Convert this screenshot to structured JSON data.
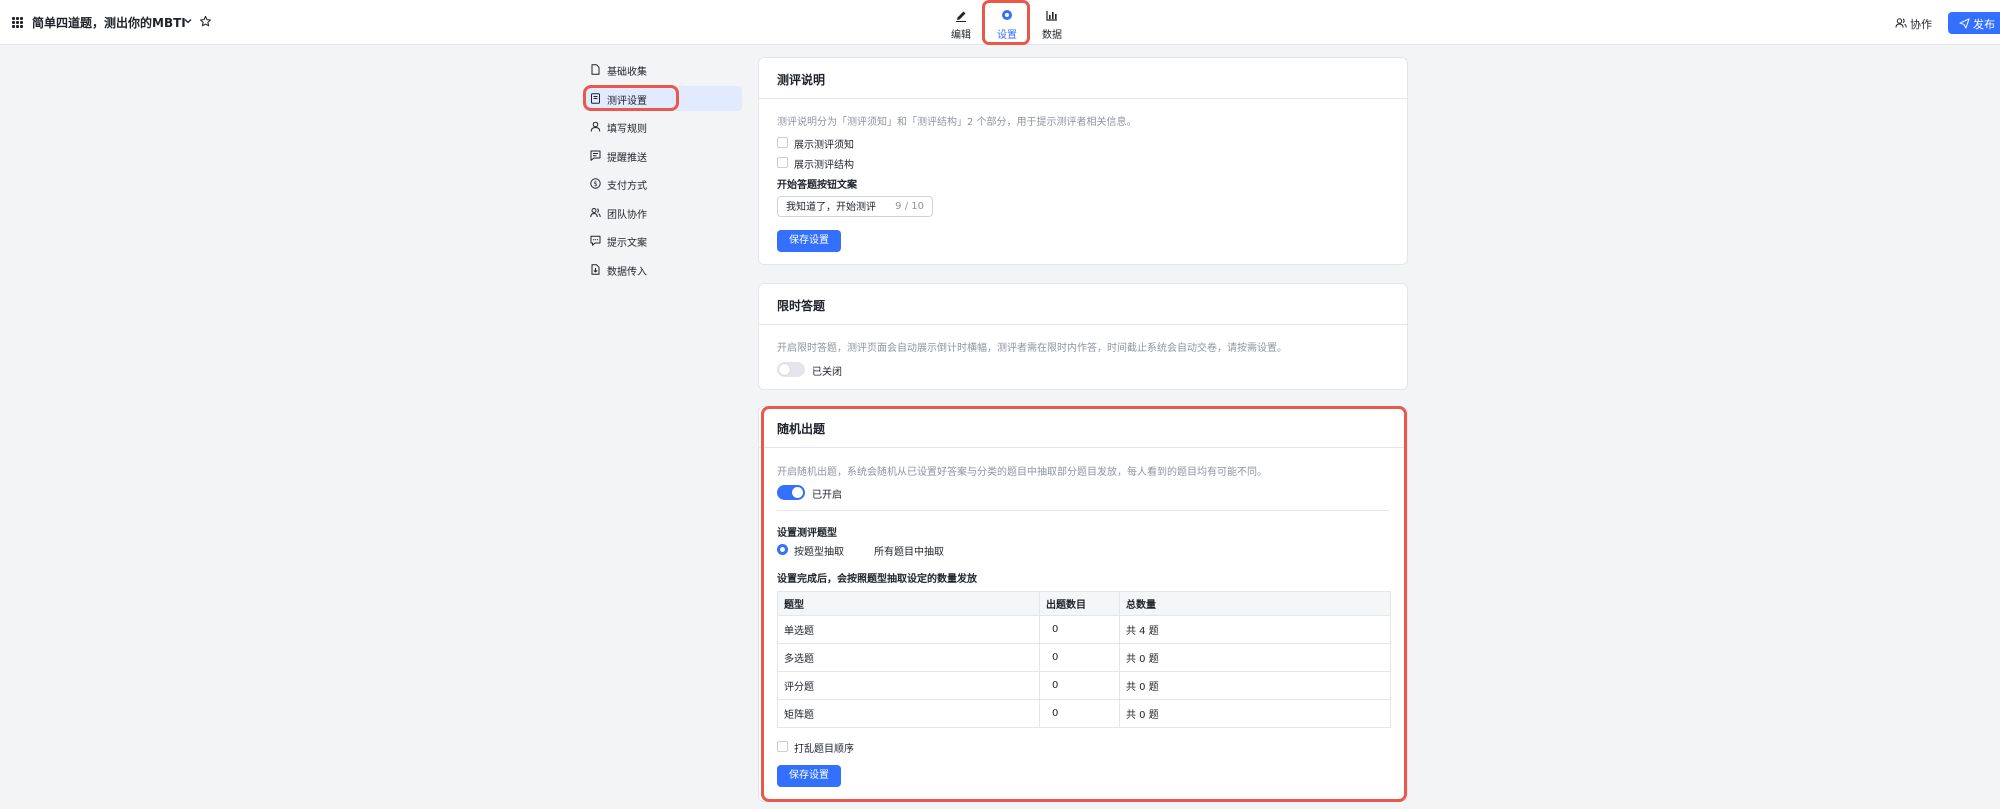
{
  "header": {
    "survey_title": "简单四道题，测出你的MBTI",
    "nav": [
      {
        "label": "编辑",
        "icon": "pen-icon"
      },
      {
        "label": "设置",
        "icon": "gear-icon",
        "active": true
      },
      {
        "label": "数据",
        "icon": "bar-chart-icon"
      }
    ],
    "collab_label": "协作",
    "publish_label": "发布"
  },
  "sidebar": {
    "items": [
      {
        "label": "基础收集",
        "icon": "file-icon"
      },
      {
        "label": "测评设置",
        "icon": "assessment-icon",
        "active": true
      },
      {
        "label": "填写规则",
        "icon": "user-icon"
      },
      {
        "label": "提醒推送",
        "icon": "message-icon"
      },
      {
        "label": "支付方式",
        "icon": "dollar-icon"
      },
      {
        "label": "团队协作",
        "icon": "team-icon"
      },
      {
        "label": "提示文案",
        "icon": "chat-icon"
      },
      {
        "label": "数据传入",
        "icon": "import-icon"
      }
    ]
  },
  "assessment_intro": {
    "title": "测评说明",
    "description": "测评说明分为「测评须知」和「测评结构」2 个部分，用于提示测评者相关信息。",
    "show_notice_label": "展示测评须知",
    "show_structure_label": "展示测评结构",
    "button_text_label": "开始答题按钮文案",
    "button_text_value": "我知道了，开始测评",
    "button_text_count": "9 / 10",
    "save_label": "保存设置"
  },
  "timed": {
    "title": "限时答题",
    "description": "开启限时答题，测评页面会自动展示倒计时横幅，测评者需在限时内作答，时间截止系统会自动交卷，请按需设置。",
    "toggle_label": "已关闭",
    "enabled": false
  },
  "random": {
    "title": "随机出题",
    "description": "开启随机出题，系统会随机从已设置好答案与分类的题目中抽取部分题目发放，每人看到的题目均有可能不同。",
    "toggle_label": "已开启",
    "enabled": true,
    "type_label": "设置测评题型",
    "option_by_type": "按题型抽取",
    "option_all": "所有题目中抽取",
    "table_caption": "设置完成后，会按照题型抽取设定的数量发放",
    "table_headers": [
      "题型",
      "出题数目",
      "总数量"
    ],
    "rows": [
      {
        "type": "单选题",
        "count": "0",
        "total": "共 4 题"
      },
      {
        "type": "多选题",
        "count": "0",
        "total": "共 0 题"
      },
      {
        "type": "评分题",
        "count": "0",
        "total": "共 0 题"
      },
      {
        "type": "矩阵题",
        "count": "0",
        "total": "共 0 题"
      }
    ],
    "shuffle_label": "打乱题目顺序",
    "save_label": "保存设置"
  },
  "colors": {
    "accent": "#3370ff",
    "highlight": "#e8584b"
  }
}
